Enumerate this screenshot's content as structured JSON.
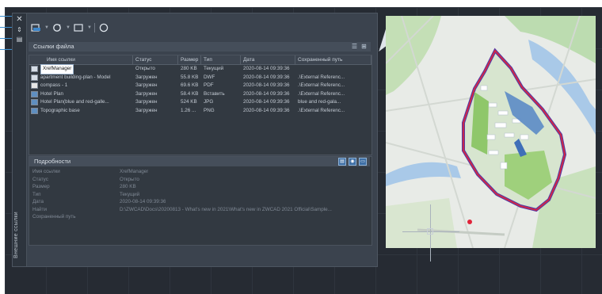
{
  "sidebar": {
    "title": "Внешние ссылки",
    "close_glyph": "✕"
  },
  "toolbar": {
    "buttons": [
      "attach-dwg-icon",
      "refresh-icon",
      "change-path-icon",
      "help-icon"
    ]
  },
  "file_refs": {
    "title": "Ссылки файла",
    "columns": [
      "Имя ссылки",
      "Статус",
      "Размер",
      "Тип",
      "Дата",
      "Сохраненный путь"
    ],
    "rows": [
      {
        "name": "XrefManager",
        "status": "Открыто",
        "size": "280 KB",
        "type": "Текущий",
        "date": "2020-08-14 09:39:36",
        "path": "",
        "icon": "dwg",
        "selected": true
      },
      {
        "name": "apartment building-plan - Model",
        "status": "Загружен",
        "size": "55.8 KB",
        "type": "DWF",
        "date": "2020-08-14 09:39:36",
        "path": ".\\External Referenc...",
        "icon": "dwf",
        "selected": false
      },
      {
        "name": "compass - 1",
        "status": "Загружен",
        "size": "69.6 KB",
        "type": "PDF",
        "date": "2020-08-14 09:39:36",
        "path": ".\\External Referenc...",
        "icon": "pdf",
        "selected": false
      },
      {
        "name": "Hotel Plan",
        "status": "Загружен",
        "size": "58.4 KB",
        "type": "Вставить",
        "date": "2020-08-14 09:39:36",
        "path": ".\\External Referenc...",
        "icon": "dwg",
        "selected": false
      },
      {
        "name": "Hotel Plan(blue and red-galle...",
        "status": "Загружен",
        "size": "524 KB",
        "type": "JPG",
        "date": "2020-08-14 09:39:36",
        "path": "blue and red-gala...",
        "icon": "img",
        "selected": false
      },
      {
        "name": "Topographic base",
        "status": "Загружен",
        "size": "1.26 ...",
        "type": "PNG",
        "date": "2020-08-14 09:39:36",
        "path": ".\\External Referenc...",
        "icon": "img",
        "selected": false
      }
    ]
  },
  "details": {
    "title": "Подробности",
    "rows": [
      {
        "label": "Имя ссылки",
        "value": "XrefManager"
      },
      {
        "label": "Статус",
        "value": "Открыто"
      },
      {
        "label": "Размер",
        "value": "280 KB"
      },
      {
        "label": "Тип",
        "value": "Текущий"
      },
      {
        "label": "Дата",
        "value": "2020-08-14 09:39:36"
      },
      {
        "label": "Найти",
        "value": "D:\\ZWCAD\\Docs\\20200813 - What's new in 2021\\What's new in ZWCAD 2021 Official\\Sample..."
      },
      {
        "label": "Сохраненный путь",
        "value": ""
      }
    ]
  },
  "colors": {
    "canvas": "#262b33",
    "palette": "#3b434e",
    "boundary": "#e0243a",
    "boundary_inner": "#5b3aa0",
    "park": "#8fc76a",
    "water": "#a9c9e8"
  }
}
